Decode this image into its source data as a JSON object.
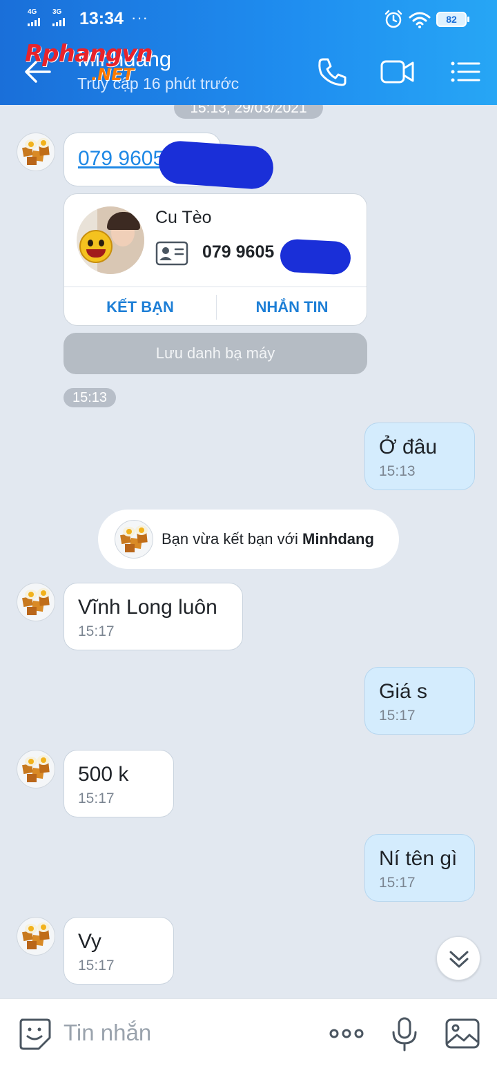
{
  "status": {
    "net1": "4G",
    "net2": "3G",
    "time": "13:34",
    "more": "···",
    "battery": "82"
  },
  "header": {
    "contact_name": "Minhdang",
    "last_seen": "Truy cập 16 phút trước",
    "watermark_main": "Rphangvn",
    "watermark_sub": ".NET"
  },
  "chat": {
    "date_separator": "15:13, 29/03/2021",
    "shared_phone": "079 9605",
    "contact_card": {
      "name": "Cu Tèo",
      "phone": "079 9605",
      "add_friend_label": "KẾT BẠN",
      "message_label": "NHẮN TIN",
      "save_label": "Lưu danh bạ máy"
    },
    "card_time": "15:13",
    "messages": [
      {
        "side": "me",
        "text": "Ở đâu",
        "time": "15:13"
      },
      {
        "side": "them",
        "text": "Vĩnh Long luôn",
        "time": "15:17"
      },
      {
        "side": "me",
        "text": "Giá s",
        "time": "15:17"
      },
      {
        "side": "them",
        "text": "500 k",
        "time": "15:17"
      },
      {
        "side": "me",
        "text": "Ní tên gì",
        "time": "15:17"
      },
      {
        "side": "them",
        "text": "Vy",
        "time": "15:17"
      }
    ],
    "system_notice": {
      "prefix": "Bạn vừa kết bạn với ",
      "name": "Minhdang"
    }
  },
  "input": {
    "placeholder": "Tin nhắn"
  },
  "colors": {
    "header_start": "#1a6fd9",
    "header_end": "#27a6f5",
    "my_bubble": "#d4ecfd",
    "chat_bg": "#e2e8f0",
    "link": "#1e88e5"
  }
}
